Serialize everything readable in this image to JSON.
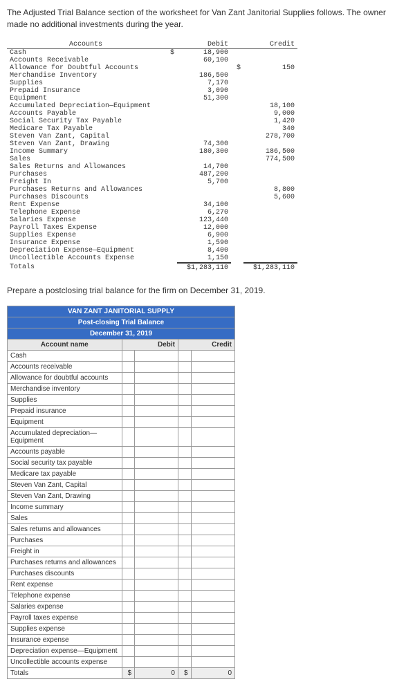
{
  "intro": "The Adjusted Trial Balance section of the worksheet for Van Zant Janitorial Supplies follows. The owner made no additional investments during the year.",
  "adj_header": {
    "accounts": "Accounts",
    "debit": "Debit",
    "credit": "Credit"
  },
  "adj_rows": [
    {
      "name": "Cash",
      "dd": "$",
      "debit": "18,900",
      "cd": "",
      "credit": ""
    },
    {
      "name": "Accounts Receivable",
      "dd": "",
      "debit": "60,100",
      "cd": "",
      "credit": ""
    },
    {
      "name": "Allowance for Doubtful Accounts",
      "dd": "",
      "debit": "",
      "cd": "$",
      "credit": "150"
    },
    {
      "name": "Merchandise Inventory",
      "dd": "",
      "debit": "186,500",
      "cd": "",
      "credit": ""
    },
    {
      "name": "Supplies",
      "dd": "",
      "debit": "7,170",
      "cd": "",
      "credit": ""
    },
    {
      "name": "Prepaid Insurance",
      "dd": "",
      "debit": "3,090",
      "cd": "",
      "credit": ""
    },
    {
      "name": "Equipment",
      "dd": "",
      "debit": "51,300",
      "cd": "",
      "credit": ""
    },
    {
      "name": "Accumulated Depreciation—Equipment",
      "dd": "",
      "debit": "",
      "cd": "",
      "credit": "18,100"
    },
    {
      "name": "Accounts Payable",
      "dd": "",
      "debit": "",
      "cd": "",
      "credit": "9,000"
    },
    {
      "name": "Social Security Tax Payable",
      "dd": "",
      "debit": "",
      "cd": "",
      "credit": "1,420"
    },
    {
      "name": "Medicare Tax Payable",
      "dd": "",
      "debit": "",
      "cd": "",
      "credit": "340"
    },
    {
      "name": "Steven Van Zant, Capital",
      "dd": "",
      "debit": "",
      "cd": "",
      "credit": "278,700"
    },
    {
      "name": "Steven Van Zant, Drawing",
      "dd": "",
      "debit": "74,300",
      "cd": "",
      "credit": ""
    },
    {
      "name": "Income Summary",
      "dd": "",
      "debit": "180,300",
      "cd": "",
      "credit": "186,500"
    },
    {
      "name": "Sales",
      "dd": "",
      "debit": "",
      "cd": "",
      "credit": "774,500"
    },
    {
      "name": "Sales Returns and Allowances",
      "dd": "",
      "debit": "14,700",
      "cd": "",
      "credit": ""
    },
    {
      "name": "Purchases",
      "dd": "",
      "debit": "487,200",
      "cd": "",
      "credit": ""
    },
    {
      "name": "Freight In",
      "dd": "",
      "debit": "5,700",
      "cd": "",
      "credit": ""
    },
    {
      "name": "Purchases Returns and Allowances",
      "dd": "",
      "debit": "",
      "cd": "",
      "credit": "8,800"
    },
    {
      "name": "Purchases Discounts",
      "dd": "",
      "debit": "",
      "cd": "",
      "credit": "5,600"
    },
    {
      "name": "Rent Expense",
      "dd": "",
      "debit": "34,100",
      "cd": "",
      "credit": ""
    },
    {
      "name": "Telephone Expense",
      "dd": "",
      "debit": "6,270",
      "cd": "",
      "credit": ""
    },
    {
      "name": "Salaries Expense",
      "dd": "",
      "debit": "123,440",
      "cd": "",
      "credit": ""
    },
    {
      "name": "Payroll Taxes Expense",
      "dd": "",
      "debit": "12,000",
      "cd": "",
      "credit": ""
    },
    {
      "name": "Supplies Expense",
      "dd": "",
      "debit": "6,900",
      "cd": "",
      "credit": ""
    },
    {
      "name": "Insurance Expense",
      "dd": "",
      "debit": "1,590",
      "cd": "",
      "credit": ""
    },
    {
      "name": "Depreciation Expense—Equipment",
      "dd": "",
      "debit": "8,400",
      "cd": "",
      "credit": ""
    },
    {
      "name": "Uncollectible Accounts Expense",
      "dd": "",
      "debit": "1,150",
      "cd": "",
      "credit": ""
    }
  ],
  "adj_totals": {
    "name": "Totals",
    "debit": "$1,283,110",
    "credit": "$1,283,110"
  },
  "instruction": "Prepare a postclosing trial balance for the firm on December 31, 2019.",
  "pc_title1": "VAN ZANT JANITORIAL SUPPLY",
  "pc_title2": "Post-closing Trial Balance",
  "pc_title3": "December 31, 2019",
  "pc_colhdr": {
    "acct": "Account name",
    "debit": "Debit",
    "credit": "Credit"
  },
  "pc_accounts": [
    "Cash",
    "Accounts receivable",
    "Allowance for doubtful accounts",
    "Merchandise inventory",
    "Supplies",
    "Prepaid insurance",
    "Equipment",
    "Accumulated depreciation—Equipment",
    "Accounts payable",
    "Social security tax payable",
    "Medicare tax payable",
    "Steven Van Zant, Capital",
    "Steven Van Zant, Drawing",
    "Income summary",
    "Sales",
    "Sales returns and allowances",
    "Purchases",
    "Freight in",
    "Purchases returns and allowances",
    "Purchases discounts",
    "Rent expense",
    "Telephone expense",
    "Salaries expense",
    "Payroll taxes expense",
    "Supplies expense",
    "Insurance expense",
    "Depreciation expense—Equipment",
    "Uncollectible accounts expense"
  ],
  "pc_totals": {
    "name": "Totals",
    "dd": "$",
    "debit": "0",
    "cd": "$",
    "credit": "0"
  }
}
